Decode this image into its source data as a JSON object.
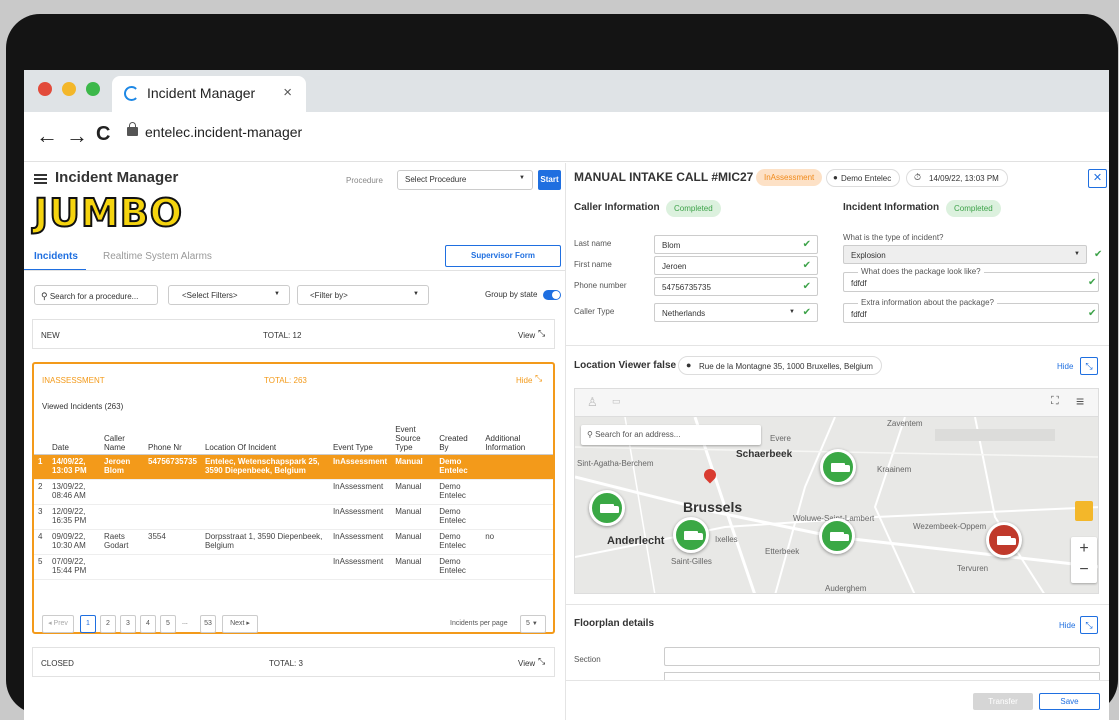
{
  "browser": {
    "tab_title": "Incident Manager",
    "tab_close": "×",
    "url": "entelec.incident-manager",
    "back": "←",
    "forward": "→",
    "reload": "C"
  },
  "header": {
    "app_title": "Incident Manager",
    "procedure_label": "Procedure",
    "procedure_select": "Select Procedure",
    "start_button": "Start",
    "logo_text": "JUMBO"
  },
  "tabs": {
    "incidents": "Incidents",
    "alarms": "Realtime System Alarms",
    "supervisor_button": "Supervisor Form"
  },
  "filters": {
    "search_placeholder": "Search for a procedure...",
    "select_filters": "<Select Filters>",
    "filter_by": "<Filter by>",
    "group_by_state": "Group by state"
  },
  "sections": {
    "new": {
      "label": "NEW",
      "total": "TOTAL: 12",
      "action": "View"
    },
    "inassessment": {
      "label": "INASSESSMENT",
      "total": "TOTAL: 263",
      "action": "Hide"
    },
    "closed": {
      "label": "CLOSED",
      "total": "TOTAL: 3",
      "action": "View"
    }
  },
  "table": {
    "caption": "Viewed Incidents (263)",
    "headers": [
      "",
      "Date",
      "Caller Name",
      "Phone Nr",
      "Location Of Incident",
      "Event Type",
      "Event Source Type",
      "Created By",
      "Additional Information"
    ],
    "rows": [
      [
        "1",
        "14/09/22, 13:03 PM",
        "Jeroen Blom",
        "54756735735",
        "Entelec, Wetenschapspark 25, 3590 Diepenbeek, Belgium",
        "InAssessment",
        "Manual",
        "Demo Entelec",
        ""
      ],
      [
        "2",
        "13/09/22, 08:46 AM",
        "",
        "",
        "",
        "InAssessment",
        "Manual",
        "Demo Entelec",
        ""
      ],
      [
        "3",
        "12/09/22, 16:35 PM",
        "",
        "",
        "",
        "InAssessment",
        "Manual",
        "Demo Entelec",
        ""
      ],
      [
        "4",
        "09/09/22, 10:30 AM",
        "Raets Godart",
        "3554",
        "Dorpsstraat 1, 3590 Diepenbeek, Belgium",
        "InAssessment",
        "Manual",
        "Demo Entelec",
        "no"
      ],
      [
        "5",
        "07/09/22, 15:44 PM",
        "",
        "",
        "",
        "InAssessment",
        "Manual",
        "Demo Entelec",
        ""
      ]
    ]
  },
  "pagination": {
    "prev": "◂ Prev",
    "pages": [
      "1",
      "2",
      "3",
      "4",
      "5",
      "...",
      "53"
    ],
    "next": "Next ▸",
    "per_page_label": "Incidents per page",
    "per_page_value": "5"
  },
  "call": {
    "title": "MANUAL INTAKE CALL #MIC27",
    "status": "InAssessment",
    "user": "Demo Entelec",
    "time": "14/09/22, 13:03 PM",
    "close": "✕"
  },
  "caller": {
    "heading": "Caller Information",
    "status": "Completed",
    "fields": [
      {
        "label": "Last name",
        "value": "Blom"
      },
      {
        "label": "First name",
        "value": "Jeroen"
      },
      {
        "label": "Phone number",
        "value": "54756735735"
      },
      {
        "label": "Caller Type",
        "value": "Netherlands"
      }
    ]
  },
  "incident": {
    "heading": "Incident Information",
    "status": "Completed",
    "type_question": "What is the type of incident?",
    "type_value": "Explosion",
    "package_question": "What does the package look like?",
    "package_value": "fdfdf",
    "extra_question": "Extra information about the package?",
    "extra_value": "fdfdf"
  },
  "location": {
    "heading": "Location Viewer false",
    "address": "Rue de la Montagne 35, 1000 Bruxelles, Belgium",
    "hide": "Hide",
    "map_search_placeholder": "Search for an address...",
    "places": [
      "Schaerbeek",
      "Brussels",
      "Anderlecht",
      "Sint-Agatha-Berchem",
      "Kraainem",
      "Woluwe-Saint-Lambert",
      "Wezembeek-Oppem",
      "Ixelles",
      "Etterbeek",
      "Saint-Gilles",
      "Tervuren",
      "Auderghem",
      "Zaventem",
      "Evere"
    ],
    "zoom_in": "+",
    "zoom_out": "−"
  },
  "floorplan": {
    "heading": "Floorplan details",
    "hide": "Hide",
    "section_label": "Section"
  },
  "footer": {
    "transfer": "Transfer",
    "save": "Save"
  },
  "colors": {
    "accent": "#1f6fe0",
    "orange": "#f39a1a",
    "green_marker": "#3aa845",
    "red_marker": "#c0392b",
    "completed_bg": "#dcf1de",
    "inassessment_bg": "#fde1c6"
  }
}
